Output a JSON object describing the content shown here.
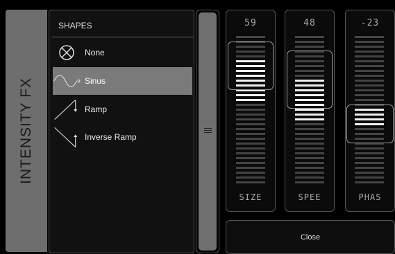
{
  "sidebar": {
    "title": "INTENSITY FX"
  },
  "shapes": {
    "header": "SHAPES",
    "items": [
      {
        "label": "None",
        "icon": "none-circle-x-icon",
        "selected": false
      },
      {
        "label": "Sinus",
        "icon": "sine-wave-icon",
        "selected": true
      },
      {
        "label": "Ramp",
        "icon": "ramp-icon",
        "selected": false
      },
      {
        "label": "Inverse Ramp",
        "icon": "inverse-ramp-icon",
        "selected": false
      }
    ]
  },
  "faders": [
    {
      "name": "SIZE",
      "value": "59",
      "level": 0.59
    },
    {
      "name": "SPEE",
      "value": "48",
      "level": 0.48
    },
    {
      "name": "PHAS",
      "value": "-23",
      "level": 0.385
    }
  ],
  "close_button": {
    "label": "Close"
  },
  "colors": {
    "background": "#000000",
    "panel": "#111111",
    "selected": "#7a7a7a",
    "sidebar": "#6e6e6e",
    "lit": "#f2f2f2",
    "unlit": "#444444"
  }
}
